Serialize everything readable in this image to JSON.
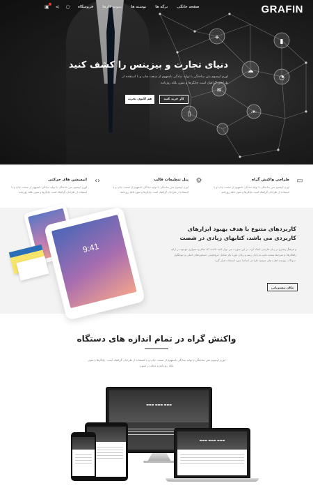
{
  "nav": {
    "logo": "GRAFIN",
    "menu": [
      "صفحه خانگی",
      "برگه ها",
      "نوشته ها",
      "نمونه کارها",
      "فروشگاه"
    ]
  },
  "hero": {
    "title": "دنیای تجارت و بیزینس را کشف کنید",
    "text": "لورم ایپسوم متن ساختگی با تولید سادگی نامفهوم از صنعت چاپ و با استفاده از طراحان گرافیک است چاپگرها و متون بلکه روزنامه",
    "btn_primary": "هم اکنون بخرید",
    "btn_secondary": "کار خرید کنید"
  },
  "features": [
    {
      "title": "طراحی واکنش گراه",
      "text": "لورم ایپسوم متن ساختگی با تولید سادگی نامفهوم از صنعت چاپ و با استفاده از طراحان گرافیک است چاپگرها و متون بلکه روزنامه",
      "icon": "monitor-icon"
    },
    {
      "title": "پنل تنظیمات قالب",
      "text": "لورم ایپسوم متن ساختگی با تولید سادگی نامفهوم از صنعت چاپ و با استفاده از طراحان گرافیک است چاپگرها و متون بلکه روزنامه",
      "icon": "gear-icon"
    },
    {
      "title": "انیمیشن های حرکتی",
      "text": "لورم ایپسوم متن ساختگی با تولید سادگی نامفهوم از صنعت چاپ و با استفاده از طراحان گرافیک است چاپگرها و متون بلکه روزنامه",
      "icon": "code-icon"
    }
  ],
  "section2": {
    "title": "کاربردهای متنوع با هدف بهبود ابزارهای کاربردی می باشد، کتابهای زیادی در شصت",
    "text": "و فرهنگ پیشرو در زبان فارسی ایجاد کرد. در این صورت می توان امید داشت که تمام و دشواری موجود در ارائه راهکارها، و شرایط سخت تایپ به پایان رسد و زمان مورد نیاز شامل حروفچینی دستاوردهای اصلی و جوابگوی سوالات پیوسته اهل دنیای موجود طراحی اساسا مورد استفاده قرار گیرد.",
    "button": "مکان بیشتریابی",
    "tablet_time": "9:41"
  },
  "section3": {
    "title": "واکنش گراه در تمام اندازه های دستگاه",
    "text": "لورم ایپسوم متن ساختگی با تولید سادگی نامفهوم از صنعت چاپ و با استفاده از طراحان گرافیک است. چاپگرها و متون بلکه روزنامه و مجله در ستون"
  }
}
